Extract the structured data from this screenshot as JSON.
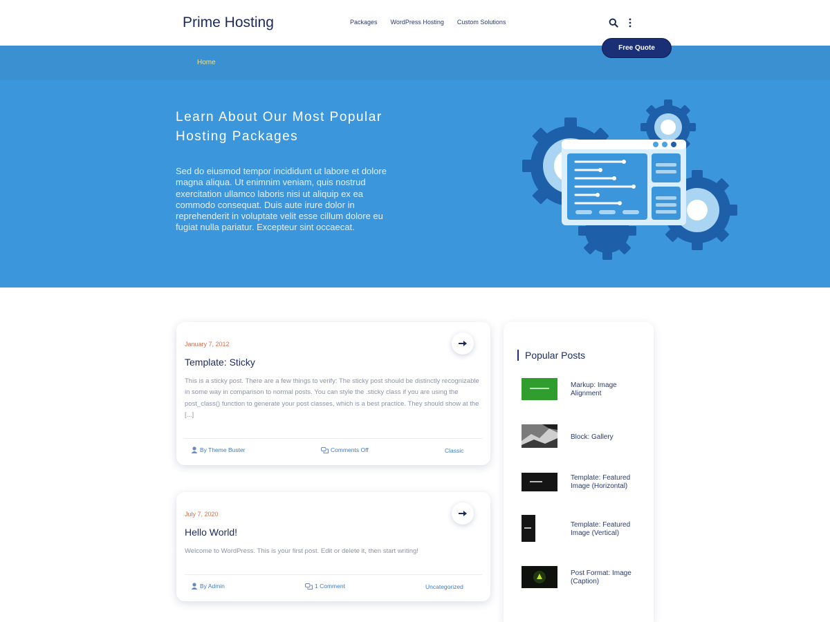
{
  "header": {
    "logo": "Prime Hosting",
    "nav": [
      "Packages",
      "WordPress Hosting",
      "Custom Solutions"
    ],
    "quote_button": "Free Quote"
  },
  "breadcrumb": {
    "home": "Home"
  },
  "hero": {
    "title": "Learn About Our Most Popular Hosting Packages",
    "text": "Sed do eiusmod tempor incididunt ut labore et dolore magna aliqua. Ut enimnim veniam, quis nostrud exercitation ullamco laboris nisi ut aliquip ex ea commodo consequat. Duis aute irure dolor in reprehenderit in voluptate velit esse cillum dolore eu fugiat nulla pariatur. Excepteur sint occaecat."
  },
  "posts": [
    {
      "date": "January 7, 2012",
      "title": "Template: Sticky",
      "excerpt": "This is a sticky post. There are a few things to verify: The sticky post should be distinctly recognizable in some way in comparison to normal posts. You can style the .sticky class if you are using the post_class() function to generate your post classes, which is a best practice. They should show at the [...]",
      "author": "By Theme Buster",
      "comments": "Comments Off",
      "category": "Classic"
    },
    {
      "date": "July 7, 2020",
      "title": "Hello World!",
      "excerpt": "Welcome to WordPress. This is your first post. Edit or delete it, then start writing!",
      "author": "By Admin",
      "comments": "1 Comment",
      "category": "Uncategorized"
    }
  ],
  "sidebar": {
    "title": "Popular Posts",
    "items": [
      {
        "label": "Markup: Image Alignment",
        "thumb_color": "#2f9e2f"
      },
      {
        "label": "Block: Gallery",
        "thumb_color": "#6b6b6b"
      },
      {
        "label": "Template: Featured Image (Horizontal)",
        "thumb_color": "#151515"
      },
      {
        "label": "Template: Featured Image (Vertical)",
        "thumb_color": "#151515"
      },
      {
        "label": "Post Format: Image (Caption)",
        "thumb_color": "#0f120c"
      }
    ]
  },
  "colors": {
    "brand_dark": "#1b2f77",
    "hero_blue": "#3b96db",
    "crumb_blue": "#3a90d1",
    "accent_date": "#d9714d"
  }
}
